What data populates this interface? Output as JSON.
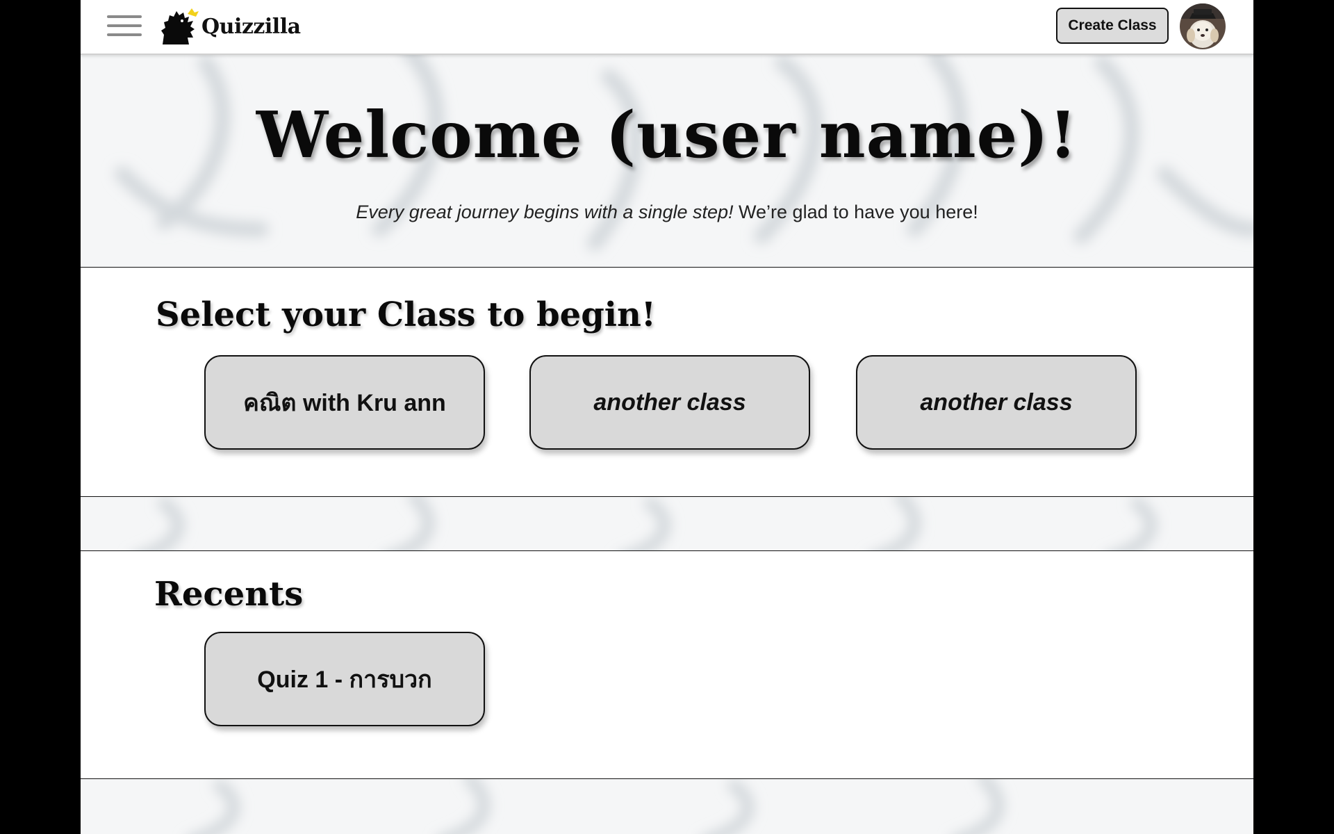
{
  "header": {
    "brand": "Quizzilla",
    "create_class_label": "Create Class",
    "menu_icon": "hamburger-menu-icon",
    "logo_icon": "godzilla-logo-icon",
    "avatar_icon": "user-avatar-icon"
  },
  "hero": {
    "title": "Welcome (user name)!",
    "subtitle_italic": "Every great journey begins with a single step!",
    "subtitle_rest": " We’re glad to have you here!"
  },
  "classes": {
    "heading": "Select your Class to begin!",
    "items": [
      {
        "label": "คณิต with Kru ann",
        "italic": false
      },
      {
        "label": "another class",
        "italic": true
      },
      {
        "label": "another class",
        "italic": true
      }
    ]
  },
  "recents": {
    "heading": "Recents",
    "items": [
      {
        "label": "Quiz 1 - การบวก"
      }
    ]
  },
  "colors": {
    "page_bg": "#ffffff",
    "outer_bg": "#000000",
    "card_bg": "#d9d9d9",
    "swirl_bg": "#f5f6f7"
  }
}
